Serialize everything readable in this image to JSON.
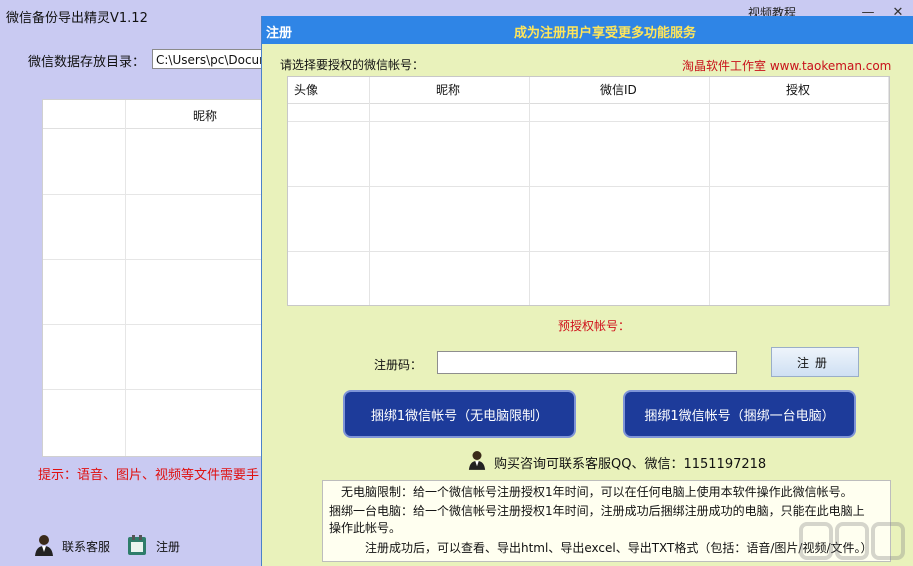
{
  "main": {
    "title": "微信备份导出精灵V1.12",
    "top_right_link": "视频教程",
    "dir_label": "微信数据存放目录：",
    "dir_value": "C:\\Users\\pc\\Documents",
    "table_header": "昵称",
    "tip": "提示：语音、图片、视频等文件需要手",
    "contact_service": "联系客服",
    "register": "注册"
  },
  "dialog": {
    "title": "注册",
    "slogan": "成为注册用户享受更多功能服务",
    "select_label": "请选择要授权的微信帐号：",
    "studio": "淘晶软件工作室  www.taokeman.com",
    "columns": [
      "头像",
      "昵称",
      "微信ID",
      "授权"
    ],
    "pre_auth_label": "预授权帐号：",
    "code_label": "注册码：",
    "code_value": "",
    "register_button": "注册",
    "bind_no_limit": "捆绑1微信帐号（无电脑限制）",
    "bind_one_pc": "捆绑1微信帐号（捆绑一台电脑）",
    "contact": "购买咨询可联系客服QQ、微信：1151197218",
    "info": [
      "无电脑限制：给一个微信帐号注册授权1年时间，可以在任何电脑上使用本软件操作此微信帐号。",
      "捆绑一台电脑：给一个微信帐号注册授权1年时间，注册成功后捆绑注册成功的电脑，只能在此电脑上",
      "操作此帐号。",
      "注册成功后，可以查看、导出html、导出excel、导出TXT格式（包括：语音/图片/视频/文件。）"
    ]
  },
  "colors": {
    "main_bg": "#c9caf2",
    "dialog_bg": "#e9f2bb",
    "titlebar": "#2f85e6",
    "slogan": "#ffe65a",
    "bind_button": "#1d3b9a",
    "alert_red": "#d0101a"
  },
  "icons": [
    "service-person-icon",
    "register-icon",
    "minimize-icon",
    "close-icon"
  ]
}
